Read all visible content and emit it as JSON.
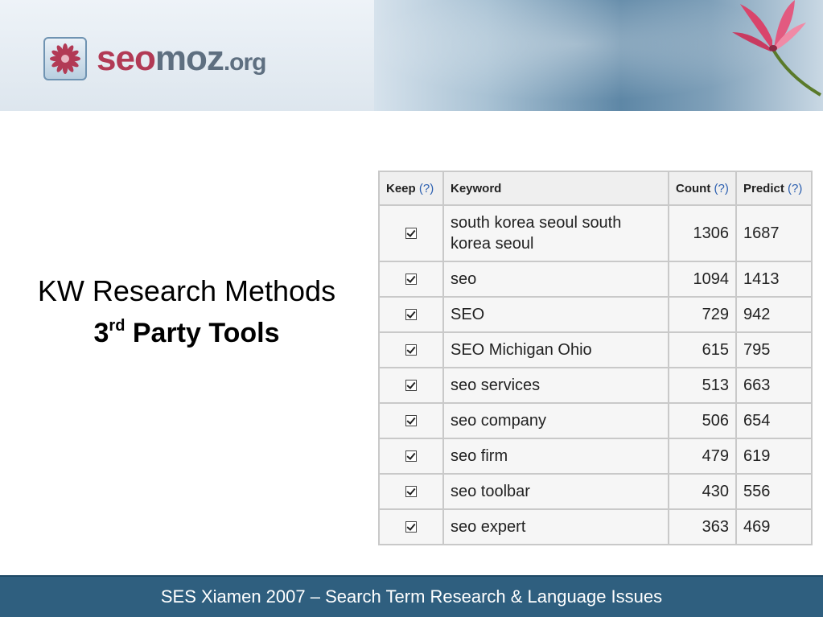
{
  "header": {
    "logo": {
      "seo": "seo",
      "moz": "moz",
      "org": ".org"
    }
  },
  "title": {
    "line1": "KW Research Methods",
    "line2_num": "3",
    "line2_sup": "rd",
    "line2_rest": " Party Tools"
  },
  "table": {
    "headers": {
      "keep": "Keep",
      "keep_help": "(?)",
      "keyword": "Keyword",
      "count": "Count",
      "count_help": "(?)",
      "predict": "Predict",
      "predict_help": "(?)"
    },
    "rows": [
      {
        "keep": true,
        "keyword": "south korea seoul south korea seoul",
        "count": "1306",
        "predict": "1687"
      },
      {
        "keep": true,
        "keyword": "seo",
        "count": "1094",
        "predict": "1413"
      },
      {
        "keep": true,
        "keyword": "SEO",
        "count": "729",
        "predict": "942"
      },
      {
        "keep": true,
        "keyword": "SEO Michigan Ohio",
        "count": "615",
        "predict": "795"
      },
      {
        "keep": true,
        "keyword": "seo services",
        "count": "513",
        "predict": "663"
      },
      {
        "keep": true,
        "keyword": "seo company",
        "count": "506",
        "predict": "654"
      },
      {
        "keep": true,
        "keyword": "seo firm",
        "count": "479",
        "predict": "619"
      },
      {
        "keep": true,
        "keyword": "seo toolbar",
        "count": "430",
        "predict": "556"
      },
      {
        "keep": true,
        "keyword": "seo expert",
        "count": "363",
        "predict": "469"
      }
    ]
  },
  "footer": {
    "text": "SES Xiamen 2007 – Search Term Research & Language Issues"
  },
  "colors": {
    "brand_seo": "#b23a55",
    "brand_moz": "#5e6f80",
    "footer_bg": "#2f5f7f",
    "help_link": "#2b5fb0"
  },
  "icons": [
    "flower-logo-icon",
    "flower-photo-icon",
    "checkbox-checked-icon"
  ]
}
